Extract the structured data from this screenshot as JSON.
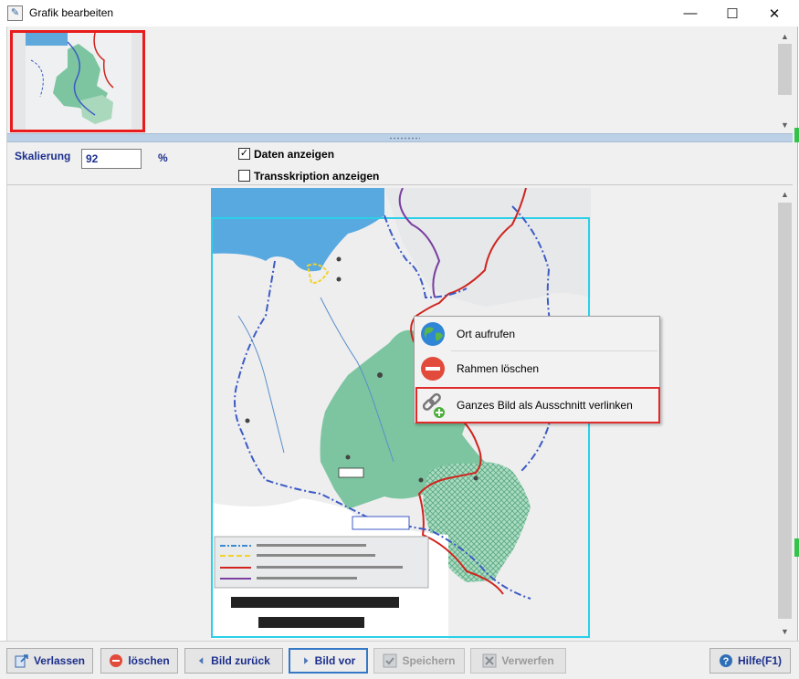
{
  "window": {
    "title": "Grafik bearbeiten",
    "controls": {
      "minimize": "—",
      "maximize": "☐",
      "close": "✕"
    }
  },
  "settings": {
    "scale_label": "Skalierung",
    "scale_value": "92",
    "scale_unit": "%",
    "show_data_label": "Daten anzeigen",
    "show_data_checked": true,
    "show_transcription_label": "Transskription anzeigen",
    "show_transcription_checked": false
  },
  "context_menu": {
    "items": [
      {
        "label": "Ort aufrufen",
        "icon": "globe-icon"
      },
      {
        "label": "Rahmen löschen",
        "icon": "remove-icon"
      },
      {
        "label": "Ganzes Bild als Ausschnitt verlinken",
        "icon": "link-add-icon",
        "highlighted": true
      }
    ]
  },
  "toolbar": {
    "buttons": [
      {
        "label": "Verlassen",
        "icon": "exit-icon",
        "enabled": true
      },
      {
        "label": "löschen",
        "icon": "delete-icon",
        "enabled": true
      },
      {
        "label": "Bild zurück",
        "icon": "arrow-left-icon",
        "enabled": true
      },
      {
        "label": "Bild vor",
        "icon": "arrow-right-icon",
        "enabled": true,
        "focused": true
      },
      {
        "label": "Speichern",
        "icon": "save-icon",
        "enabled": false
      },
      {
        "label": "Verwerfen",
        "icon": "discard-icon",
        "enabled": false
      },
      {
        "label": "Hilfe(F1)",
        "icon": "help-icon",
        "enabled": true
      }
    ]
  },
  "colors": {
    "accent": "#1c2f8c",
    "selection_border": "#e81c1c",
    "map_frame": "#2ad0e8",
    "govt_general_green": "#7cc5a0"
  }
}
